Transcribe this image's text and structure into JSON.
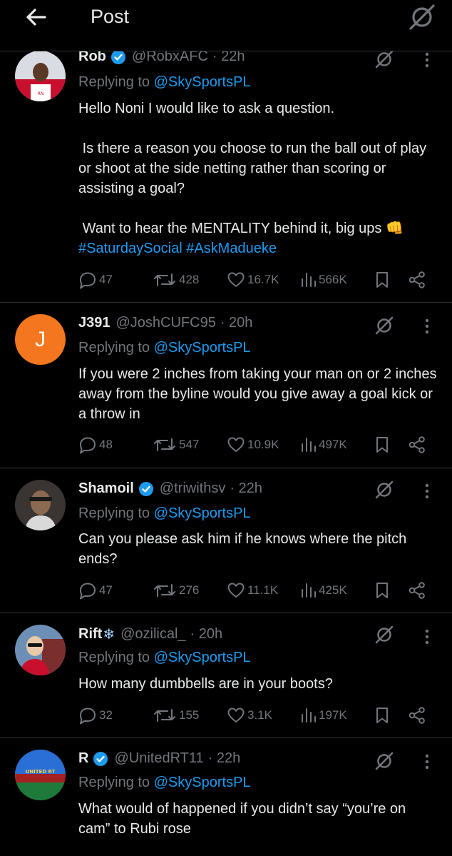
{
  "header": {
    "title": "Post",
    "back_icon": "arrow-left-icon",
    "grok_icon": "grok-icon"
  },
  "colors": {
    "background": "#000000",
    "text": "#e7e9ea",
    "muted": "#71767b",
    "link": "#1d9bf0",
    "verified": "#1d9bf0",
    "divider": "#2f3336"
  },
  "tweets": [
    {
      "name": "Rob",
      "verified": true,
      "handle": "@RobxAFC",
      "time": "· 22h",
      "replying_label": "Replying to",
      "replying_to": "@SkySportsPL",
      "paragraphs": [
        "Hello Noni I would like to ask a question.",
        " Is there a reason you choose to run the ball out of play or shoot at the side netting rather than scoring or assisting a goal?",
        " Want to hear the MENTALITY behind it, big ups 👊"
      ],
      "hashtags": "#SaturdaySocial #AskMadueke",
      "stats": {
        "replies": "47",
        "reposts": "428",
        "likes": "16.7K",
        "views": "566K"
      }
    },
    {
      "name": "J391",
      "verified": false,
      "handle": "@JoshCUFC95",
      "time": "· 20h",
      "avatar_letter": "J",
      "replying_label": "Replying to",
      "replying_to": "@SkySportsPL",
      "paragraphs": [
        "If you were 2 inches from taking your man on or 2 inches away from the byline would you give away a goal kick or a throw in"
      ],
      "stats": {
        "replies": "48",
        "reposts": "547",
        "likes": "10.9K",
        "views": "497K"
      }
    },
    {
      "name": "Shamoil",
      "verified": true,
      "handle": "@triwithsv",
      "time": "· 22h",
      "replying_label": "Replying to",
      "replying_to": "@SkySportsPL",
      "paragraphs": [
        "Can you please ask him if he knows where the pitch ends?"
      ],
      "stats": {
        "replies": "47",
        "reposts": "276",
        "likes": "11.1K",
        "views": "425K"
      }
    },
    {
      "name": "Rift",
      "name_suffix": "❄",
      "verified": false,
      "handle": "@ozilical_",
      "time": "· 20h",
      "replying_label": "Replying to",
      "replying_to": "@SkySportsPL",
      "paragraphs": [
        "How many dumbbells are in your boots?"
      ],
      "stats": {
        "replies": "32",
        "reposts": "155",
        "likes": "3.1K",
        "views": "197K"
      }
    },
    {
      "name": "R",
      "verified": true,
      "handle": "@UnitedRT11",
      "time": "· 22h",
      "avatar_text": "UNITED RT",
      "replying_label": "Replying to",
      "replying_to": "@SkySportsPL",
      "paragraphs": [
        "What would of happened if you didn’t say “you’re on cam” to Rubi rose"
      ]
    }
  ]
}
